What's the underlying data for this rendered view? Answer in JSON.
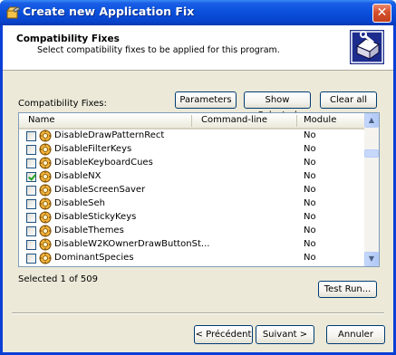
{
  "window": {
    "title": "Create new Application Fix",
    "close_glyph": "✕"
  },
  "header": {
    "title": "Compatibility Fixes",
    "subtitle": "Select compatibility fixes to be applied for this program.",
    "icon": "wizard-tools-icon"
  },
  "fixes_label": "Compatibility Fixes:",
  "buttons": {
    "parameters": "Parameters",
    "show_selected": "Show Selected",
    "clear_all": "Clear all",
    "test_run": "Test Run...",
    "back": "< Précédent",
    "next": "Suivant >",
    "cancel": "Annuler"
  },
  "list": {
    "columns": [
      "Name",
      "Command-line",
      "Module"
    ],
    "rows": [
      {
        "name": "DisableDrawPatternRect",
        "module": "No",
        "checked": false
      },
      {
        "name": "DisableFilterKeys",
        "module": "No",
        "checked": false
      },
      {
        "name": "DisableKeyboardCues",
        "module": "No",
        "checked": false
      },
      {
        "name": "DisableNX",
        "module": "No",
        "checked": true
      },
      {
        "name": "DisableScreenSaver",
        "module": "No",
        "checked": false
      },
      {
        "name": "DisableSeh",
        "module": "No",
        "checked": false
      },
      {
        "name": "DisableStickyKeys",
        "module": "No",
        "checked": false
      },
      {
        "name": "DisableThemes",
        "module": "No",
        "checked": false
      },
      {
        "name": "DisableW2KOwnerDrawButtonSt...",
        "module": "No",
        "checked": false
      },
      {
        "name": "DominantSpecies",
        "module": "No",
        "checked": false
      }
    ]
  },
  "status": "Selected 1 of 509"
}
